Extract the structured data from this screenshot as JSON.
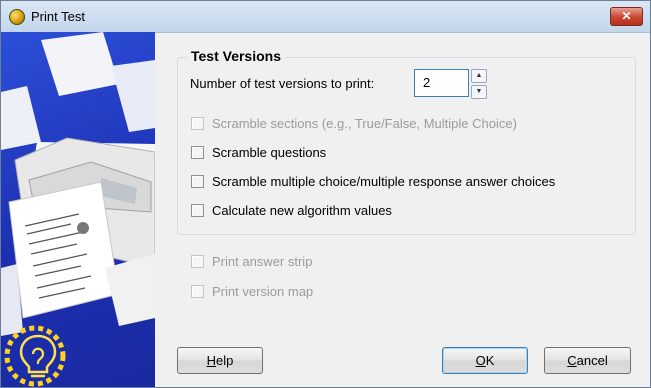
{
  "window": {
    "title": "Print Test",
    "close_glyph": "✕"
  },
  "test_versions": {
    "group_title": "Test Versions",
    "num_versions_label": "Number of test versions to print:",
    "num_versions_value": "2",
    "options": [
      {
        "label": "Scramble sections (e.g., True/False, Multiple Choice)",
        "checked": false,
        "enabled": false
      },
      {
        "label": "Scramble questions",
        "checked": false,
        "enabled": true
      },
      {
        "label": "Scramble multiple choice/multiple response answer choices",
        "checked": false,
        "enabled": true
      },
      {
        "label": "Calculate new algorithm values",
        "checked": false,
        "enabled": true
      }
    ]
  },
  "print_options": [
    {
      "label": "Print answer strip",
      "checked": false,
      "enabled": false
    },
    {
      "label": "Print version map",
      "checked": false,
      "enabled": false
    }
  ],
  "buttons": {
    "help": {
      "mnemonic": "H",
      "rest": "elp"
    },
    "ok": {
      "mnemonic": "O",
      "rest": "K"
    },
    "cancel": {
      "mnemonic": "C",
      "rest": "ancel"
    }
  },
  "icons": [
    "app-icon",
    "close-icon",
    "printer-illustration",
    "lightbulb-icon",
    "spin-up-icon",
    "spin-down-icon"
  ]
}
